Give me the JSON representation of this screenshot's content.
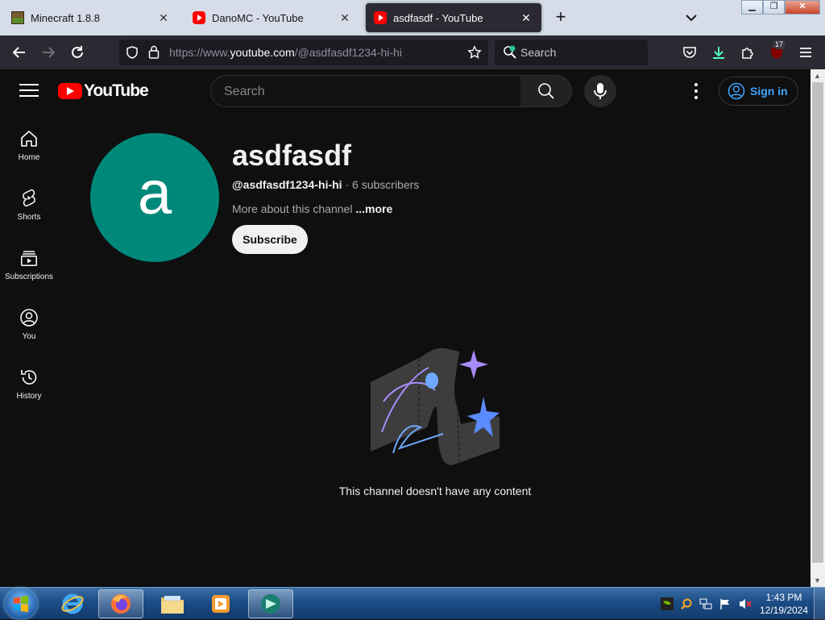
{
  "browser": {
    "tabs": [
      {
        "title": "Minecraft 1.8.8",
        "favicon": "minecraft-icon",
        "active": false
      },
      {
        "title": "DanoMC - YouTube",
        "favicon": "youtube-icon",
        "active": false
      },
      {
        "title": "asdfasdf - YouTube",
        "favicon": "youtube-icon",
        "active": true
      }
    ],
    "new_tab_label": "+",
    "url_prefix": "https://www.",
    "url_domain": "youtube.com",
    "url_path": "/@asdfasdf1234-hi-hi",
    "search_placeholder": "Search",
    "notification_count": "17"
  },
  "youtube": {
    "logo_text": "YouTube",
    "search_placeholder": "Search",
    "sign_in_label": "Sign in",
    "sidebar": [
      {
        "label": "Home",
        "icon": "home-icon"
      },
      {
        "label": "Shorts",
        "icon": "shorts-icon"
      },
      {
        "label": "Subscriptions",
        "icon": "subscriptions-icon"
      },
      {
        "label": "You",
        "icon": "you-icon"
      },
      {
        "label": "History",
        "icon": "history-icon"
      }
    ],
    "channel": {
      "avatar_letter": "a",
      "avatar_color": "#00897b",
      "name": "asdfasdf",
      "handle": "@asdfasdf1234-hi-hi",
      "separator": " · ",
      "subscribers": "6 subscribers",
      "about_text": "More about this channel ",
      "about_more": "...more",
      "subscribe_label": "Subscribe"
    },
    "empty_message": "This channel doesn't have any content"
  },
  "taskbar": {
    "items": [
      "internet-explorer-icon",
      "firefox-icon",
      "file-explorer-icon",
      "media-player-icon",
      "app-icon"
    ],
    "time": "1:43 PM",
    "date": "12/19/2024"
  },
  "colors": {
    "accent_red": "#ff0000",
    "link_blue": "#3ea6ff",
    "background": "#0f0f0f"
  }
}
